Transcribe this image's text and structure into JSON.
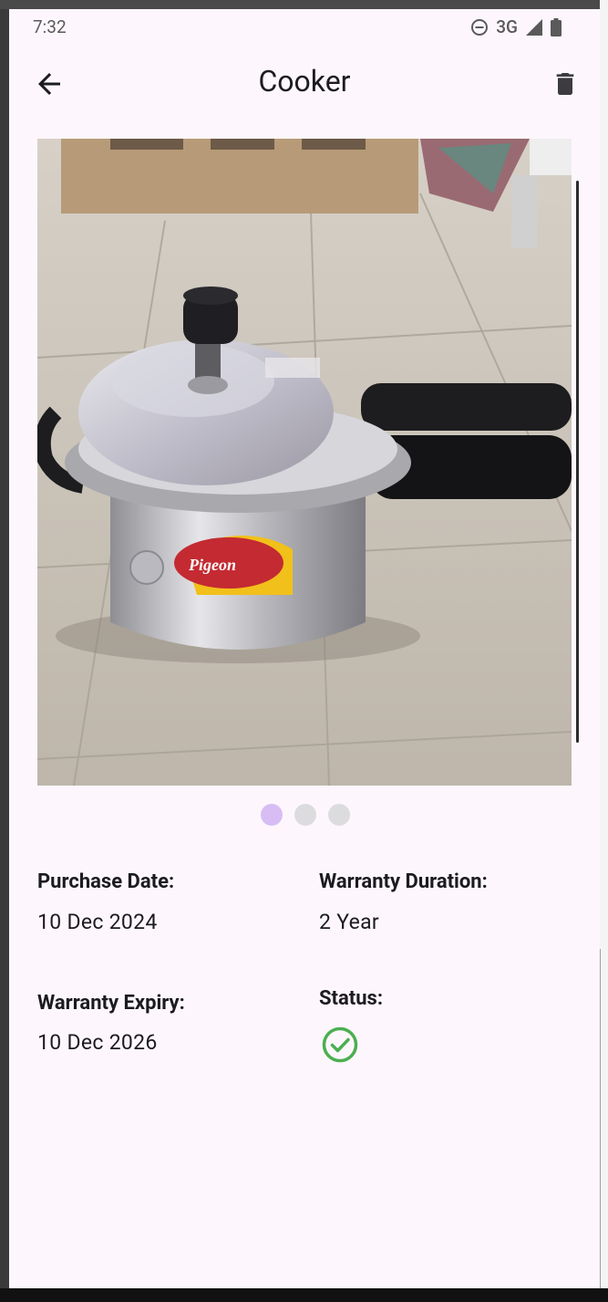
{
  "status_bar": {
    "time": "7:32",
    "network": "3G"
  },
  "app_bar": {
    "title": "Cooker",
    "back_icon": "arrow-left-icon",
    "delete_icon": "trash-icon"
  },
  "gallery": {
    "image_description": "pressure-cooker-photo",
    "page_count": 3,
    "active_page": 1,
    "active_dot_color": "#d8bdf5",
    "inactive_dot_color": "#dcdcde"
  },
  "details": {
    "purchase_date_label": "Purchase Date:",
    "purchase_date_value": "10 Dec 2024",
    "warranty_duration_label": "Warranty Duration:",
    "warranty_duration_value": "2 Year",
    "warranty_expiry_label": "Warranty Expiry:",
    "warranty_expiry_value": "10 Dec 2026",
    "status_label": "Status:",
    "status_icon": "check-circle-icon",
    "status_color": "#4caf50"
  }
}
